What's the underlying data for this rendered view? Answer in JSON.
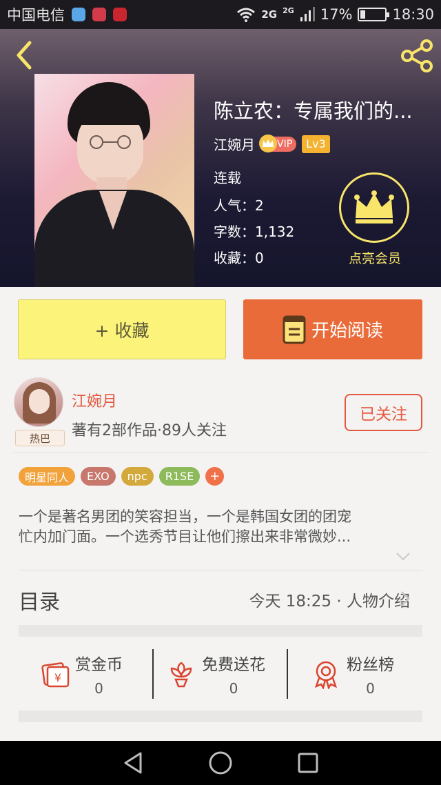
{
  "status_bar": {
    "carrier": "中国电信",
    "network": "2G",
    "network2": "2G",
    "battery": "17%",
    "time": "18:30"
  },
  "book": {
    "title": "陈立农：专属我们的...",
    "author": "江婉月",
    "vip_label": "VIP",
    "level": "Lv3",
    "status": "连载",
    "popularity_label": "人气：",
    "popularity": "2",
    "word_count_label": "字数：",
    "word_count": "1,132",
    "favorites_label": "收藏：",
    "favorites": "0",
    "member_label": "点亮会员"
  },
  "actions": {
    "collect_label": "+ 收藏",
    "read_label": "开始阅读"
  },
  "author_section": {
    "name": "江婉月",
    "badge": "热巴",
    "stats": "著有2部作品·89人关注",
    "follow_label": "已关注"
  },
  "tags": [
    {
      "label": "明星同人",
      "color": "#f2a23a"
    },
    {
      "label": "EXO",
      "color": "#c7776c"
    },
    {
      "label": "npc",
      "color": "#d4a93c"
    },
    {
      "label": "R1SE",
      "color": "#8dba5a"
    },
    {
      "label": "+",
      "color": "#f07048"
    }
  ],
  "synopsis": {
    "line1": "一个是著名男团的笑容担当，一个是韩国女团的团宠",
    "line2": "忙内加门面。一个选秀节目让他们擦出来非常微妙..."
  },
  "toc": {
    "title": "目录",
    "latest": "今天 18:25 · 人物介绍"
  },
  "stats": [
    {
      "name": "赏金币",
      "value": "0",
      "icon": "reward-coin-icon"
    },
    {
      "name": "免费送花",
      "value": "0",
      "icon": "flower-icon"
    },
    {
      "name": "粉丝榜",
      "value": "0",
      "icon": "medal-icon"
    }
  ],
  "colors": {
    "accent_orange": "#ea6b3a",
    "collect_yellow": "#fbf37a",
    "author_red": "#e4583f",
    "member_gold": "#f8e56a"
  }
}
